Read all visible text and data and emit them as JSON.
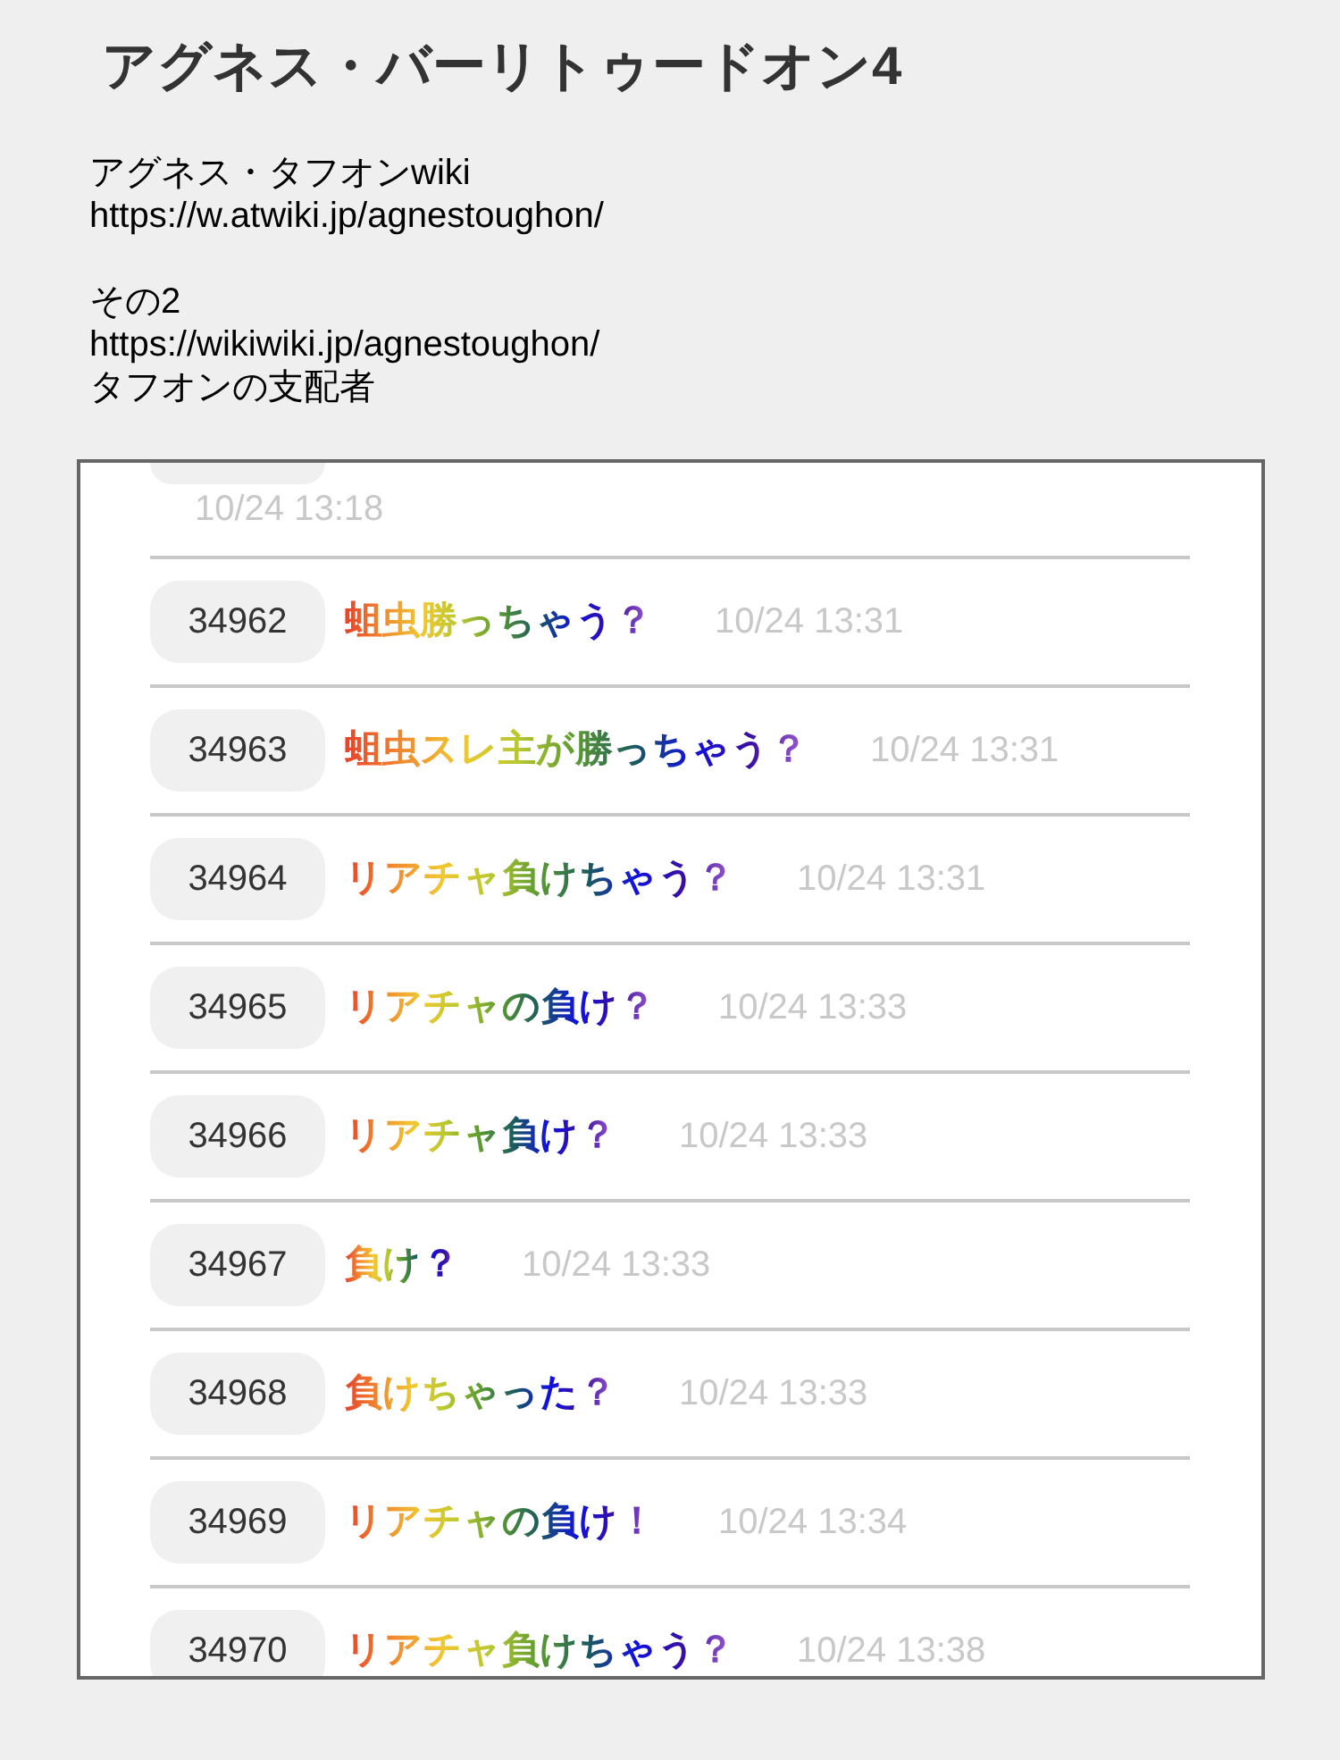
{
  "title": "アグネス・バーリトゥードオン4",
  "info_blocks": [
    {
      "lines": [
        "アグネス・タフオンwiki",
        "https://w.atwiki.jp/agnestoughon/"
      ]
    },
    {
      "lines": [
        "その2",
        "https://wikiwiki.jp/agnestoughon/",
        "タフオンの支配者"
      ]
    }
  ],
  "posts": [
    {
      "kind": "cut_off",
      "time": "10/24 13:18"
    },
    {
      "kind": "post",
      "number": "34962",
      "text": "蛆虫勝っちゃう？",
      "time": "10/24 13:31"
    },
    {
      "kind": "post",
      "number": "34963",
      "text": "蛆虫スレ主が勝っちゃう？",
      "time": "10/24 13:31"
    },
    {
      "kind": "post",
      "number": "34964",
      "text": "リアチャ負けちゃう？",
      "time": "10/24 13:31"
    },
    {
      "kind": "post",
      "number": "34965",
      "text": "リアチャの負け？",
      "time": "10/24 13:33"
    },
    {
      "kind": "post",
      "number": "34966",
      "text": "リアチャ負け？",
      "time": "10/24 13:33"
    },
    {
      "kind": "post",
      "number": "34967",
      "text": "負け？",
      "time": "10/24 13:33"
    },
    {
      "kind": "post",
      "number": "34968",
      "text": "負けちゃった？",
      "time": "10/24 13:33"
    },
    {
      "kind": "post",
      "number": "34969",
      "text": "リアチャの負け！",
      "time": "10/24 13:34"
    },
    {
      "kind": "post",
      "number": "34970",
      "text": "リアチャ負けちゃう？",
      "time": "10/24 13:38"
    }
  ]
}
